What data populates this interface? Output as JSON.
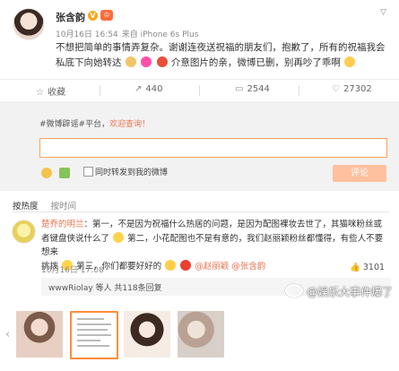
{
  "post": {
    "username": "张含韵",
    "v_badge": "V",
    "crown_badge": "♔",
    "date": "10月16日 16:54",
    "source": "来自 iPhone 6s Plus",
    "text_line1": "不想把简单的事情弄复杂。谢谢连夜送祝福的朋友们，抱歉了，所有的祝福我会",
    "text_line2_a": "私底下向她转达",
    "text_line2_b": "介意图片的亲，微博已删，别再吵了乖啊",
    "emoji_colors": [
      "#f2c46a",
      "#ff4fa8",
      "#e94e3b",
      "#ffcc4d"
    ]
  },
  "actions": {
    "favorite_label": "收藏",
    "repost_count": "440",
    "comment_count": "2544",
    "like_count": "27302"
  },
  "comment_box": {
    "notice_prefix": "#微博辟谣#平台，",
    "notice_link": "欢迎查询！",
    "checkbox_label": "同时转发到我的微博",
    "post_button": "评论"
  },
  "sort": {
    "by_hot": "按热度",
    "by_time": "按时间"
  },
  "comment": {
    "author": "楚乔的明兰",
    "line1": "：第一，不是因为祝福什么热居的问题，是因为配图裸妆去世了，其猫咪粉丝或",
    "line2": "者键盘侠说什么了",
    "line2_b": "第二，小花配图也不是有意的，我们赵丽颖粉丝都懂得，有些人不要想来",
    "line3": "挑拨",
    "line3_b": "第三，你们都要好好的",
    "mention1": "@赵丽颖",
    "mention2": "@张含韵",
    "time": "10月16日 17:08",
    "likes": "3101",
    "reply_summary": "wwwRiolay 等人 共118条回复"
  },
  "watermark": "@娱乐大事件爆了",
  "colors": {
    "accent": "#eb7350",
    "input_border": "#ffa05c",
    "button": "#ffc09f"
  }
}
